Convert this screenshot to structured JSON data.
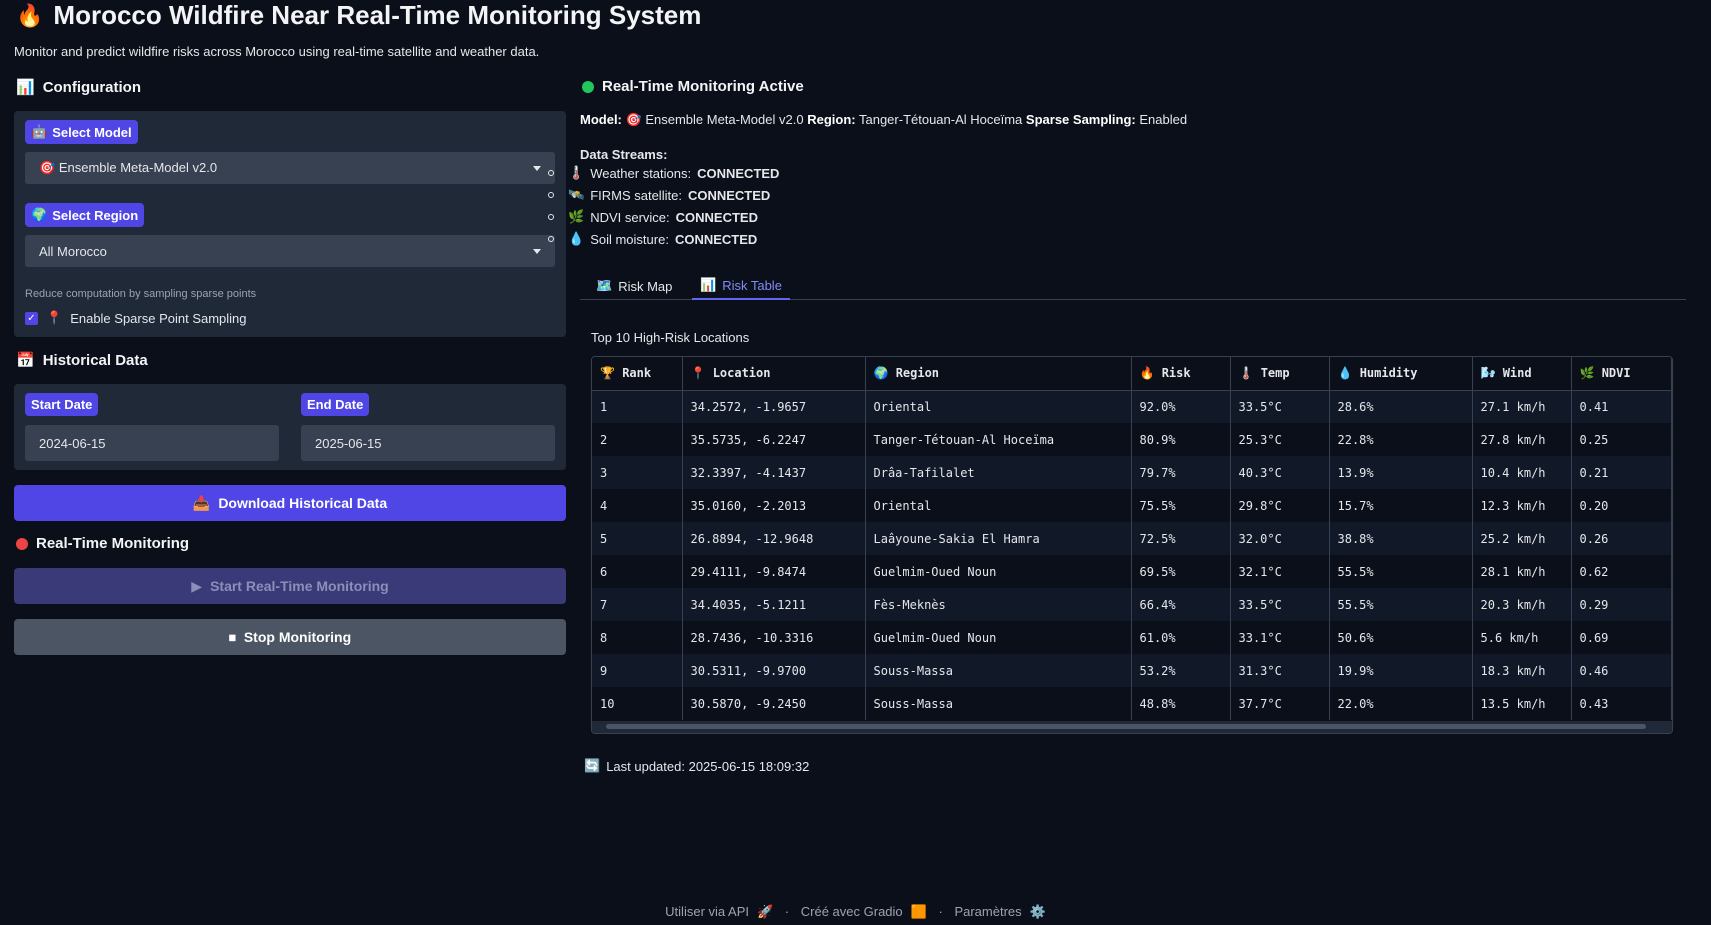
{
  "app": {
    "title": "Morocco Wildfire Near Real-Time Monitoring System",
    "description": "Monitor and predict wildfire risks across Morocco using real-time satellite and weather data."
  },
  "config": {
    "heading": "Configuration",
    "model_label": "Select Model",
    "model_value": "Ensemble Meta-Model v2.0",
    "region_label": "Select Region",
    "region_value": "All Morocco",
    "sparse_hint": "Reduce computation by sampling sparse points",
    "sparse_label": "Enable Sparse Point Sampling",
    "sparse_checked": true
  },
  "historical": {
    "heading": "Historical Data",
    "start_label": "Start Date",
    "start_value": "2024-06-15",
    "end_label": "End Date",
    "end_value": "2025-06-15",
    "download_label": "Download Historical Data"
  },
  "realtime": {
    "heading": "Real-Time Monitoring",
    "start_label": "Start Real-Time Monitoring",
    "stop_label": "Stop Monitoring"
  },
  "status": {
    "heading": "Real-Time Monitoring Active",
    "model_key": "Model:",
    "model_value": "Ensemble Meta-Model v2.0",
    "region_key": "Region:",
    "region_value": "Tanger-Tétouan-Al Hoceïma",
    "sparse_key": "Sparse Sampling:",
    "sparse_value": "Enabled",
    "streams_heading": "Data Streams:",
    "streams": [
      {
        "name": "Weather stations:",
        "state": "CONNECTED"
      },
      {
        "name": "FIRMS satellite:",
        "state": "CONNECTED"
      },
      {
        "name": "NDVI service:",
        "state": "CONNECTED"
      },
      {
        "name": "Soil moisture:",
        "state": "CONNECTED"
      }
    ]
  },
  "tabs": [
    {
      "label": "Risk Map",
      "active": false
    },
    {
      "label": "Risk Table",
      "active": true
    }
  ],
  "table": {
    "title": "Top 10 High-Risk Locations",
    "columns": [
      "Rank",
      "Location",
      "Region",
      "Risk",
      "Temp",
      "Humidity",
      "Wind",
      "NDVI"
    ],
    "rows": [
      [
        "1",
        "34.2572, -1.9657",
        "Oriental",
        "92.0%",
        "33.5°C",
        "28.6%",
        "27.1 km/h",
        "0.41"
      ],
      [
        "2",
        "35.5735, -6.2247",
        "Tanger-Tétouan-Al Hoceïma",
        "80.9%",
        "25.3°C",
        "22.8%",
        "27.8 km/h",
        "0.25"
      ],
      [
        "3",
        "32.3397, -4.1437",
        "Drâa-Tafilalet",
        "79.7%",
        "40.3°C",
        "13.9%",
        "10.4 km/h",
        "0.21"
      ],
      [
        "4",
        "35.0160, -2.2013",
        "Oriental",
        "75.5%",
        "29.8°C",
        "15.7%",
        "12.3 km/h",
        "0.20"
      ],
      [
        "5",
        "26.8894, -12.9648",
        "Laâyoune-Sakia El Hamra",
        "72.5%",
        "32.0°C",
        "38.8%",
        "25.2 km/h",
        "0.26"
      ],
      [
        "6",
        "29.4111, -9.8474",
        "Guelmim-Oued Noun",
        "69.5%",
        "32.1°C",
        "55.5%",
        "28.1 km/h",
        "0.62"
      ],
      [
        "7",
        "34.4035, -5.1211",
        "Fès-Meknès",
        "66.4%",
        "33.5°C",
        "55.5%",
        "20.3 km/h",
        "0.29"
      ],
      [
        "8",
        "28.7436, -10.3316",
        "Guelmim-Oued Noun",
        "61.0%",
        "33.1°C",
        "50.6%",
        "5.6 km/h",
        "0.69"
      ],
      [
        "9",
        "30.5311, -9.9700",
        "Souss-Massa",
        "53.2%",
        "31.3°C",
        "19.9%",
        "18.3 km/h",
        "0.46"
      ],
      [
        "10",
        "30.5870, -9.2450",
        "Souss-Massa",
        "48.8%",
        "37.7°C",
        "22.0%",
        "13.5 km/h",
        "0.43"
      ]
    ]
  },
  "updated": "Last updated: 2025-06-15 18:09:32",
  "footer": {
    "api": "Utiliser via API",
    "sep": "·",
    "built": "Créé avec Gradio",
    "settings": "Paramètres"
  },
  "colors": {
    "accent": "#4f46e5",
    "status_active": "#22c55e",
    "status_recording": "#ef4444"
  }
}
